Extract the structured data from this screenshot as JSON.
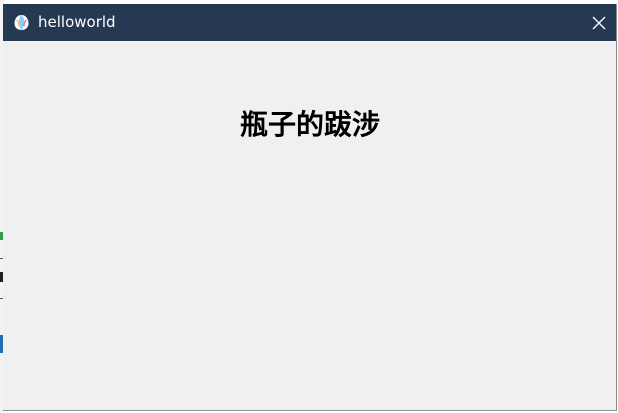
{
  "window": {
    "title": "helloworld",
    "icon": "app-logo-icon",
    "close_icon": "close-icon"
  },
  "content": {
    "heading": "瓶子的跋涉"
  },
  "colors": {
    "titlebar": "#253a52",
    "title_text": "#ffffff",
    "client_background": "#f0f0f0",
    "heading_text": "#000000"
  }
}
